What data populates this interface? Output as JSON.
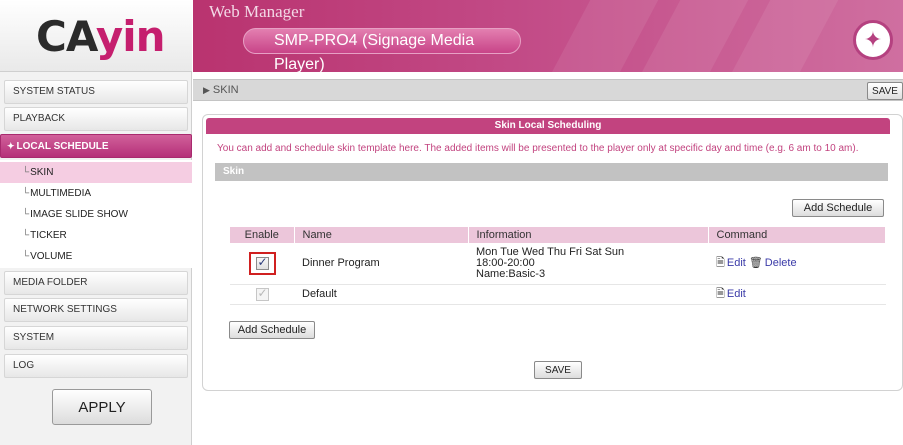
{
  "logo": {
    "text_start": "CA",
    "text_accent": "yin"
  },
  "header": {
    "title": "Web Manager",
    "product": "SMP-PRO4 (Signage Media Player)",
    "colors": {
      "brand": "#c2437f",
      "highlight": "#d02020"
    }
  },
  "sidebar": {
    "items": [
      {
        "label": "SYSTEM STATUS"
      },
      {
        "label": "PLAYBACK"
      },
      {
        "label": "LOCAL SCHEDULE",
        "icon": "star-icon"
      },
      {
        "label": "MEDIA FOLDER"
      },
      {
        "label": "NETWORK SETTINGS"
      },
      {
        "label": "SYSTEM"
      },
      {
        "label": "LOG"
      }
    ],
    "sub_items": [
      {
        "label": "SKIN",
        "prefix": "└"
      },
      {
        "label": "MULTIMEDIA",
        "prefix": "└"
      },
      {
        "label": "IMAGE SLIDE SHOW",
        "prefix": "└"
      },
      {
        "label": "TICKER",
        "prefix": "└"
      },
      {
        "label": "VOLUME",
        "prefix": "└"
      }
    ],
    "apply_label": "APPLY"
  },
  "breadcrumb": {
    "arrow": "▶",
    "label": "SKIN",
    "save_label": "SAVE"
  },
  "panel": {
    "title": "Skin Local Scheduling",
    "description": "You can add and schedule skin template here. The added items will be presented to the player only at specific day and time (e.g. 6 am to 10 am).",
    "section_label": "Skin",
    "add_schedule_label": "Add Schedule",
    "save_label": "SAVE"
  },
  "table": {
    "columns": [
      "Enable",
      "Name",
      "Information",
      "Command"
    ],
    "rows": [
      {
        "enabled": true,
        "name": "Dinner Program",
        "info": [
          "Mon Tue Wed Thu Fri Sat Sun",
          "18:00-20:00",
          "Name:Basic-3"
        ],
        "edit_label": "Edit",
        "delete_label": "Delete"
      },
      {
        "enabled": true,
        "name": "Default",
        "info": [],
        "edit_label": "Edit"
      }
    ]
  }
}
